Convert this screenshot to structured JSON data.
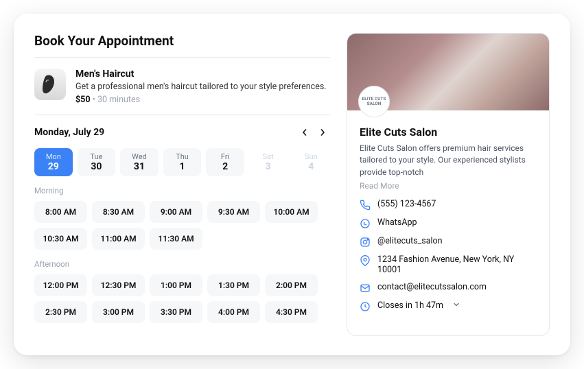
{
  "title": "Book Your Appointment",
  "service": {
    "name": "Men's Haircut",
    "desc": "Get a professional men's haircut tailored to your style preferences.",
    "price": "$50",
    "sep": " • ",
    "duration": "30 minutes"
  },
  "date": {
    "label": "Monday, July 29"
  },
  "days": [
    {
      "name": "Mon",
      "num": "29",
      "state": "selected"
    },
    {
      "name": "Tue",
      "num": "30",
      "state": ""
    },
    {
      "name": "Wed",
      "num": "31",
      "state": ""
    },
    {
      "name": "Thu",
      "num": "1",
      "state": ""
    },
    {
      "name": "Fri",
      "num": "2",
      "state": ""
    },
    {
      "name": "Sat",
      "num": "3",
      "state": "disabled"
    },
    {
      "name": "Sun",
      "num": "4",
      "state": "disabled"
    }
  ],
  "morning": {
    "label": "Morning",
    "slots": [
      "8:00 AM",
      "8:30 AM",
      "9:00 AM",
      "9:30 AM",
      "10:00 AM",
      "10:30 AM",
      "11:00 AM",
      "11:30 AM"
    ]
  },
  "afternoon": {
    "label": "Afternoon",
    "slots": [
      "12:00 PM",
      "12:30 PM",
      "1:00 PM",
      "1:30 PM",
      "2:00 PM",
      "2:30 PM",
      "3:00 PM",
      "3:30 PM",
      "4:00 PM",
      "4:30 PM"
    ]
  },
  "salon": {
    "logo_text": "ELITE CUTS\nSALON",
    "name": "Elite Cuts Salon",
    "desc": "Elite Cuts Salon offers premium hair services tailored to your style. Our experienced stylists provide top-notch",
    "read_more": "Read More",
    "phone": "(555) 123-4567",
    "whatsapp": "WhatsApp",
    "instagram": "@elitecuts_salon",
    "address": "1234 Fashion Avenue, New York, NY 10001",
    "email": "contact@elitecutssalon.com",
    "hours": "Closes in 1h 47m"
  }
}
